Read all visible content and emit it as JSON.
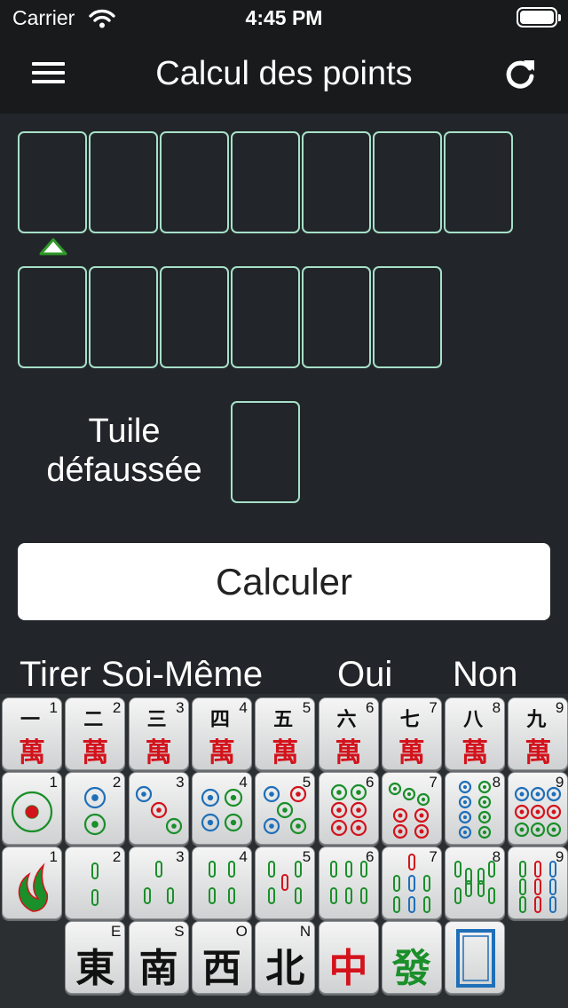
{
  "status": {
    "carrier": "Carrier",
    "time": "4:45 PM"
  },
  "nav": {
    "title": "Calcul des points"
  },
  "discard": {
    "line1": "Tuile",
    "line2": "défaussée"
  },
  "calculate_label": "Calculer",
  "self_draw": {
    "label": "Tirer Soi-Même",
    "yes": "Oui",
    "no": "Non"
  },
  "colors": {
    "slot_border": "#a6e0c8",
    "accent_green": "#1a8f2a",
    "chars_red": "#d3131c",
    "circles_blue": "#1f6fb8"
  },
  "tiles": {
    "characters": [
      {
        "number": "1",
        "top": "一",
        "bottom": "萬"
      },
      {
        "number": "2",
        "top": "二",
        "bottom": "萬"
      },
      {
        "number": "3",
        "top": "三",
        "bottom": "萬"
      },
      {
        "number": "4",
        "top": "四",
        "bottom": "萬"
      },
      {
        "number": "5",
        "top": "五",
        "bottom": "萬"
      },
      {
        "number": "6",
        "top": "六",
        "bottom": "萬"
      },
      {
        "number": "7",
        "top": "七",
        "bottom": "萬"
      },
      {
        "number": "8",
        "top": "八",
        "bottom": "萬"
      },
      {
        "number": "9",
        "top": "九",
        "bottom": "萬"
      }
    ],
    "circles": [
      "1",
      "2",
      "3",
      "4",
      "5",
      "6",
      "7",
      "8",
      "9"
    ],
    "bamboos": [
      "1",
      "2",
      "3",
      "4",
      "5",
      "6",
      "7",
      "8",
      "9"
    ],
    "honors": [
      {
        "label": "E",
        "char": "東",
        "color": "#111111"
      },
      {
        "label": "S",
        "char": "南",
        "color": "#111111"
      },
      {
        "label": "O",
        "char": "西",
        "color": "#111111"
      },
      {
        "label": "N",
        "char": "北",
        "color": "#111111"
      },
      {
        "label": "",
        "char": "中",
        "color": "#d3131c"
      },
      {
        "label": "",
        "char": "發",
        "color": "#1a8f2a"
      },
      {
        "label": "",
        "char": "",
        "color": "#1f6fb8"
      }
    ]
  }
}
